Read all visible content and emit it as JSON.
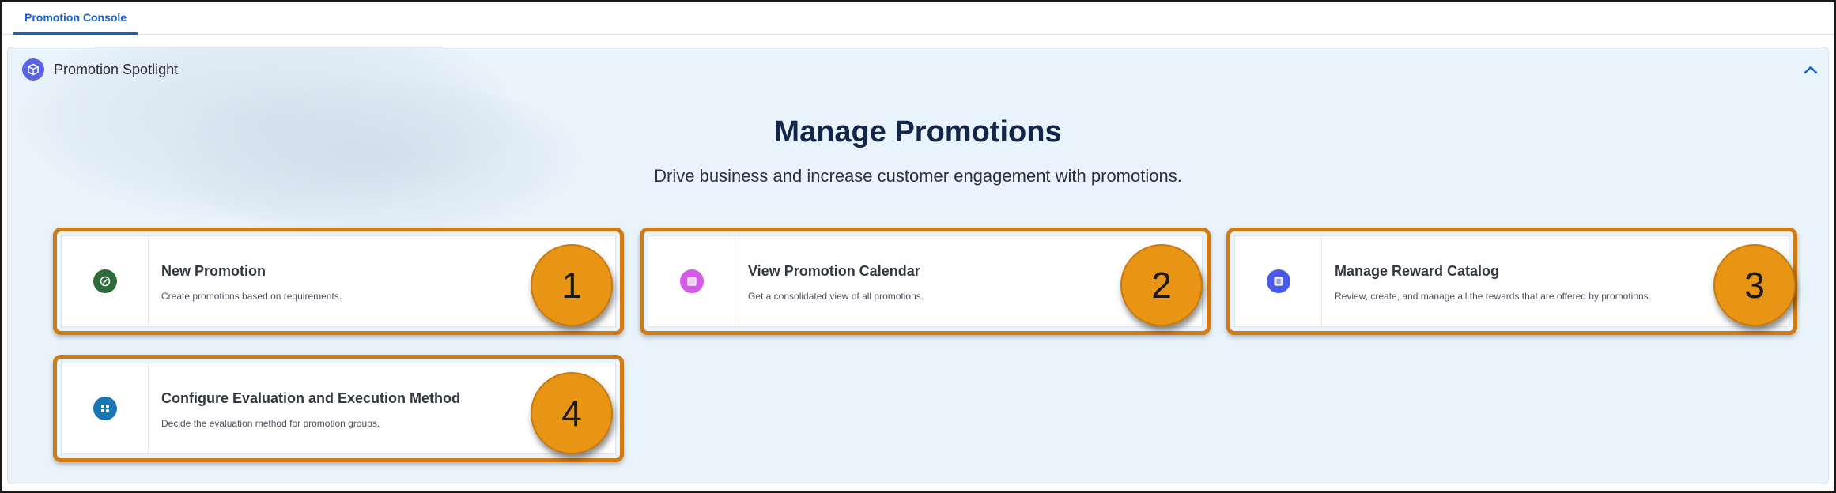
{
  "tabs": [
    {
      "label": "Promotion Console",
      "active": true
    }
  ],
  "panel": {
    "title": "Promotion Spotlight",
    "icon": "cube-icon",
    "collapse_icon": "chevron-up-icon"
  },
  "hero": {
    "title": "Manage Promotions",
    "subtitle": "Drive business and increase customer engagement with promotions."
  },
  "cards": [
    {
      "title": "New Promotion",
      "description": "Create promotions based on requirements.",
      "icon": "promotion-tag-icon",
      "icon_color": "#2e6b3a",
      "badge": "1"
    },
    {
      "title": "View Promotion Calendar",
      "description": "Get a consolidated view of all promotions.",
      "icon": "calendar-icon",
      "icon_color": "#d45be6",
      "badge": "2"
    },
    {
      "title": "Manage Reward Catalog",
      "description": "Review, create, and manage all the rewards that are offered by promotions.",
      "icon": "catalog-icon",
      "icon_color": "#4a5ae8",
      "badge": "3"
    },
    {
      "title": "Configure Evaluation and Execution Method",
      "description": "Decide the evaluation method for promotion groups.",
      "icon": "settings-flow-icon",
      "icon_color": "#1777b4",
      "badge": "4"
    }
  ],
  "colors": {
    "highlight": "#d07b14",
    "badge": "#e89415",
    "tab_accent": "#1b5fcc",
    "panel_bg": "#e9f3fb"
  }
}
